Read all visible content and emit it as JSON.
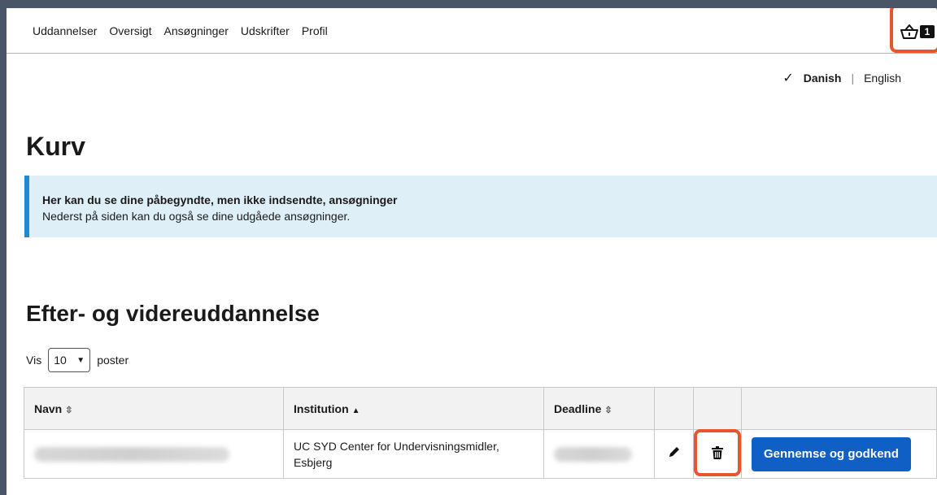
{
  "nav": {
    "items": [
      "Uddannelser",
      "Oversigt",
      "Ansøgninger",
      "Udskrifter",
      "Profil"
    ],
    "cart_count": "1"
  },
  "language": {
    "active": "Danish",
    "separator": "|",
    "other": "English"
  },
  "page_title": "Kurv",
  "info": {
    "title": "Her kan du se dine påbegyndte, men ikke indsendte, ansøgninger",
    "text": "Nederst på siden kan du også se dine udgåede ansøgninger."
  },
  "section_title": "Efter- og videreuddannelse",
  "page_size": {
    "prefix": "Vis",
    "value": "10",
    "suffix": "poster"
  },
  "table": {
    "headers": {
      "name": "Navn",
      "institution": "Institution",
      "deadline": "Deadline"
    },
    "rows": [
      {
        "institution": "UC SYD Center for Undervisningsmidler, Esbjerg",
        "action_label": "Gennemse og godkend"
      }
    ]
  },
  "colors": {
    "highlight": "#e8542b",
    "accent": "#0f5fc4",
    "info_border": "#1f8ad1",
    "info_bg": "#dfeff8"
  }
}
